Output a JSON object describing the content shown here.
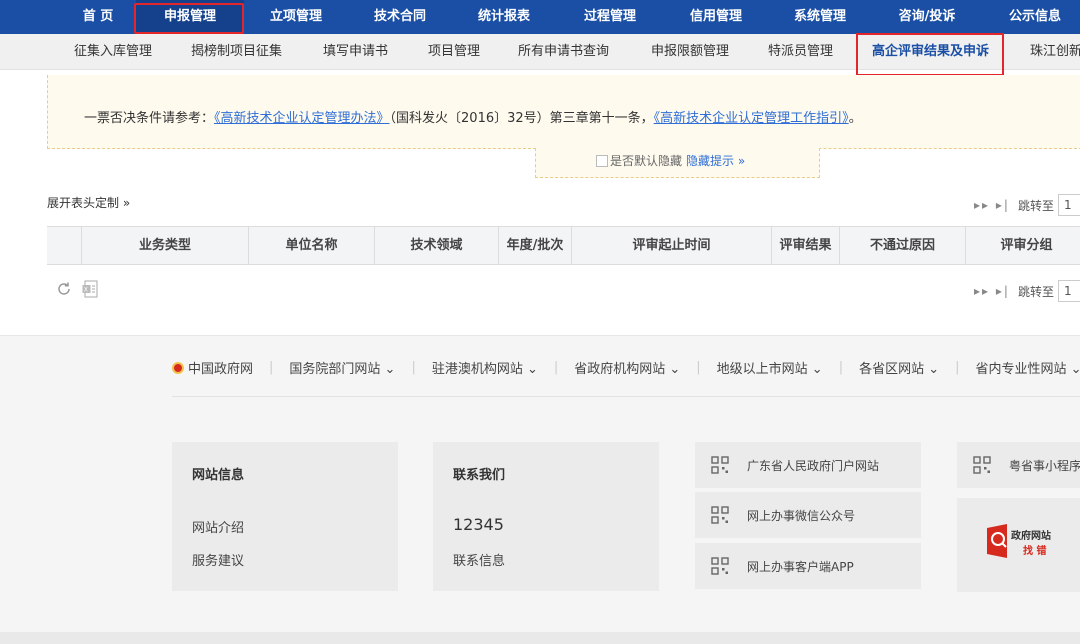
{
  "top_nav": {
    "items": [
      "首 页",
      "申报管理",
      "立项管理",
      "技术合同",
      "统计报表",
      "过程管理",
      "信用管理",
      "系统管理",
      "咨询/投诉",
      "公示信息"
    ],
    "active": "申报管理"
  },
  "sub_nav": {
    "items": [
      "征集入库管理",
      "揭榜制项目征集",
      "填写申请书",
      "项目管理",
      "所有申请书查询",
      "申报限额管理",
      "特派员管理",
      "高企评审结果及申诉",
      "珠江创新"
    ],
    "active": "高企评审结果及申诉"
  },
  "notice": {
    "prefix": "一票否决条件请参考：",
    "link1": "《高新技术企业认定管理办法》",
    "middle": "（国科发火〔2016〕32号）第三章第十一条，",
    "link2": "《高新技术企业认定管理工作指引》",
    "suffix": "。"
  },
  "hide_bar": {
    "checkbox_label": "是否默认隐藏",
    "toggle_label": "隐藏提示 »"
  },
  "table": {
    "customize_label": "展开表头定制 »",
    "columns": [
      "业务类型",
      "单位名称",
      "技术领域",
      "年度/批次",
      "评审起止时间",
      "评审结果",
      "不通过原因",
      "评审分组"
    ],
    "rows": []
  },
  "pager": {
    "arrows": "▸▸ ▸|",
    "jump_label": "跳转至",
    "page_value": "1"
  },
  "footer": {
    "links": [
      "中国政府网",
      "国务院部门网站 ⌄",
      "驻港澳机构网站 ⌄",
      "省政府机构网站 ⌄",
      "地级以上市网站 ⌄",
      "各省区网站 ⌄",
      "省内专业性网站 ⌄"
    ],
    "site_info": {
      "title": "网站信息",
      "items": [
        "网站介绍",
        "服务建议"
      ]
    },
    "contact": {
      "title": "联系我们",
      "phone": "12345",
      "info": "联系信息"
    },
    "qr_links": [
      "广东省人民政府门户网站",
      "网上办事微信公众号",
      "网上办事客户端APP"
    ],
    "qr_extra": "粤省事小程序",
    "zhaocuo": {
      "line1": "政府网站",
      "line2": "找 错"
    }
  },
  "colors": {
    "nav_bg": "#1a4fa5",
    "highlight_box": "#e3262b",
    "link": "#2f6ed6",
    "notice_bg": "#fefaee"
  }
}
